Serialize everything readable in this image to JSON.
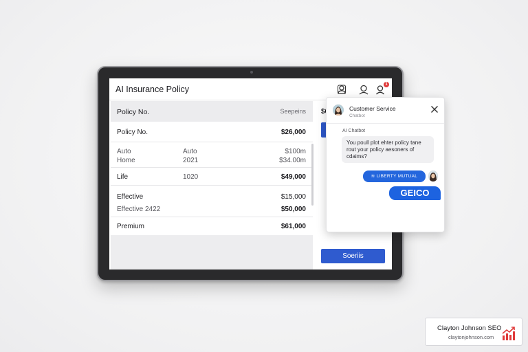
{
  "app": {
    "title": "AI Insurance Policy",
    "notification_count": "1"
  },
  "table": {
    "header": {
      "left": "Policy No.",
      "right": "Seepeins"
    },
    "rows": [
      {
        "c1": "Policy No.",
        "c2": "",
        "c3": "$26,000"
      },
      {
        "c1": "Auto",
        "c1b": "Home",
        "c2": "Auto",
        "c2b": "2021",
        "c3": "$100m",
        "c3b": "$34.00m"
      },
      {
        "c1": "Life",
        "c2": "1020",
        "c3": "$49,000"
      },
      {
        "c1": "Effective",
        "c1b": "Effective 2422",
        "c2": "",
        "c3": "$15,000",
        "c3b": "$50,000"
      },
      {
        "c1": "Premium",
        "c2": "",
        "c3": "$61,000"
      }
    ]
  },
  "side": {
    "label": "$6",
    "button": "Soeriis"
  },
  "chat": {
    "title": "Customer Service",
    "subtitle": "Chatbot",
    "bot_label": "AI Chatbot",
    "bot_message": "You poull plot ehter policy tane rout your policy aesoners of cdaims?",
    "user_msg1": "LIBERTY MUTUAL",
    "user_msg2": "GEICO"
  },
  "brand": {
    "name": "Clayton Johnson SEO",
    "url": "claytonjohnson.com"
  },
  "colors": {
    "accent": "#2f5bcf",
    "chat_blue": "#1d63e0",
    "badge": "#e03a3a",
    "logo_red": "#e03a3a"
  }
}
